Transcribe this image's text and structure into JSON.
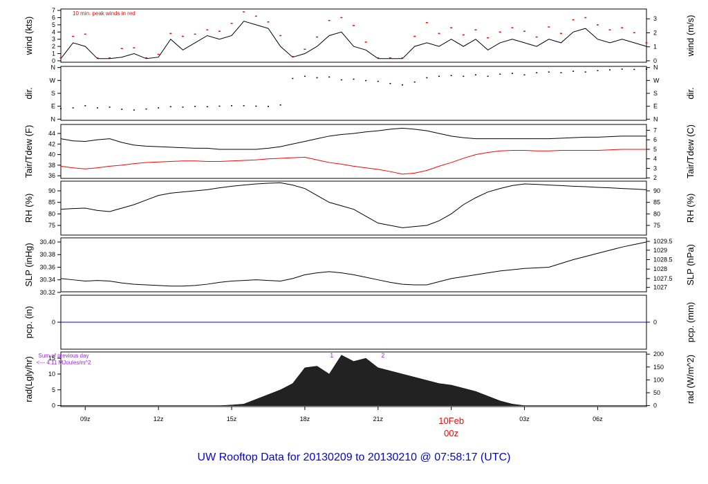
{
  "chart_data": {
    "type": "line",
    "title": "UW Rooftop Data for 20130209  to  20130210 @ 07:58:17  (UTC)",
    "time_axis": {
      "start": "20130209 08z",
      "step_hours": 0.5,
      "range_hours": [
        0,
        24
      ],
      "ticks": [
        {
          "hour": 1,
          "label": "09z"
        },
        {
          "hour": 4,
          "label": "12z"
        },
        {
          "hour": 7,
          "label": "15z"
        },
        {
          "hour": 10,
          "label": "18z"
        },
        {
          "hour": 13,
          "label": "21z"
        },
        {
          "hour": 16,
          "label": "00z",
          "date": "10Feb"
        },
        {
          "hour": 19,
          "label": "03z"
        },
        {
          "hour": 22,
          "label": "06z"
        }
      ]
    },
    "colors": {
      "main": "#000000",
      "peak": "#ff0000",
      "dewpoint": "#ff0000",
      "precip": "#0000ff",
      "annotation": "#a020f0",
      "title": "#0000ee",
      "date": "#ff0000"
    },
    "panels": [
      {
        "id": "wind",
        "left_label": "wind (kts)",
        "right_label": "wind (m/s)",
        "ylim": [
          -0.2,
          7.2
        ],
        "left_ticks": [
          {
            "v": 0,
            "label": "0"
          },
          {
            "v": 1,
            "label": "1"
          },
          {
            "v": 2,
            "label": "2"
          },
          {
            "v": 3,
            "label": "3"
          },
          {
            "v": 4,
            "label": "4"
          },
          {
            "v": 5,
            "label": "5"
          },
          {
            "v": 6,
            "label": "6"
          },
          {
            "v": 7,
            "label": "7"
          }
        ],
        "right_ticks": [
          {
            "v": 0,
            "label": "0"
          },
          {
            "v": 1.944,
            "label": "1"
          },
          {
            "v": 3.888,
            "label": "2"
          },
          {
            "v": 5.832,
            "label": "3"
          }
        ],
        "annotation": "10 min. peak winds in red",
        "series": [
          {
            "name": "wind speed",
            "style": "line",
            "color": "#000000",
            "values": [
              0.3,
              2.5,
              2.0,
              0.3,
              0.3,
              0.5,
              1.0,
              0.3,
              0.5,
              3.0,
              1.5,
              2.5,
              3.5,
              3.0,
              3.5,
              5.5,
              5.0,
              4.5,
              2.0,
              0.5,
              1.0,
              2.0,
              3.5,
              4.0,
              2.0,
              1.5,
              0.3,
              0.3,
              0.3,
              2.0,
              2.5,
              2.0,
              3.0,
              2.0,
              3.0,
              1.5,
              2.5,
              3.0,
              2.5,
              2.0,
              3.0,
              2.5,
              4.0,
              4.5,
              3.0,
              2.5,
              3.0,
              2.5,
              2.0
            ]
          },
          {
            "name": "10 min. peak wind",
            "style": "dash",
            "color": "#ff0000",
            "values": [
              0.4,
              3.4,
              3.7,
              0.4,
              0.4,
              1.7,
              1.8,
              0.4,
              0.9,
              3.8,
              3.4,
              3.7,
              4.3,
              4.1,
              5.2,
              6.8,
              6.2,
              5.4,
              3.5,
              0.6,
              1.6,
              3.3,
              5.6,
              6.0,
              4.9,
              2.6,
              0.4,
              0.4,
              0.4,
              3.4,
              5.3,
              3.8,
              4.6,
              3.6,
              4.3,
              3.2,
              4.0,
              4.6,
              4.1,
              3.3,
              4.7,
              3.8,
              5.7,
              6.0,
              5.0,
              4.3,
              4.6,
              3.9,
              2.5
            ]
          }
        ]
      },
      {
        "id": "dir",
        "left_label": "dir.",
        "right_label": "dir.",
        "ylim": [
          -8,
          368
        ],
        "left_ticks": [
          {
            "v": 0,
            "label": "N"
          },
          {
            "v": 90,
            "label": "E"
          },
          {
            "v": 180,
            "label": "S"
          },
          {
            "v": 270,
            "label": "W"
          },
          {
            "v": 360,
            "label": "N"
          }
        ],
        "right_ticks": [
          {
            "v": 0,
            "label": "N"
          },
          {
            "v": 90,
            "label": "E"
          },
          {
            "v": 180,
            "label": "S"
          },
          {
            "v": 270,
            "label": "W"
          },
          {
            "v": 360,
            "label": "N"
          }
        ],
        "series": [
          {
            "name": "wind direction",
            "style": "points",
            "color": "#000000",
            "values": [
              75,
              80,
              95,
              80,
              85,
              70,
              65,
              72,
              80,
              88,
              85,
              90,
              88,
              92,
              95,
              95,
              92,
              90,
              100,
              285,
              300,
              290,
              295,
              275,
              280,
              270,
              265,
              250,
              240,
              260,
              290,
              300,
              305,
              300,
              310,
              300,
              315,
              320,
              310,
              325,
              330,
              325,
              335,
              330,
              340,
              345,
              350,
              348,
              350
            ]
          }
        ]
      },
      {
        "id": "temp",
        "left_label": "Tair/Tdew (F)",
        "right_label": "Tair/Tdew (C)",
        "ylim": [
          35.5,
          45.7
        ],
        "left_ticks": [
          {
            "v": 36,
            "label": "36"
          },
          {
            "v": 38,
            "label": "38"
          },
          {
            "v": 40,
            "label": "40"
          },
          {
            "v": 42,
            "label": "42"
          },
          {
            "v": 44,
            "label": "44"
          }
        ],
        "right_ticks": [
          {
            "v": 35.6,
            "label": "2"
          },
          {
            "v": 37.4,
            "label": "3"
          },
          {
            "v": 39.2,
            "label": "4"
          },
          {
            "v": 41,
            "label": "5"
          },
          {
            "v": 42.8,
            "label": "6"
          },
          {
            "v": 44.6,
            "label": "7"
          }
        ],
        "series": [
          {
            "name": "air temperature",
            "style": "line",
            "color": "#000000",
            "values": [
              43.0,
              42.6,
              42.5,
              42.8,
              43.0,
              42.3,
              41.8,
              41.6,
              41.5,
              41.4,
              41.3,
              41.2,
              41.2,
              41.0,
              41.0,
              41.0,
              41.0,
              41.2,
              41.5,
              42.0,
              42.5,
              43.0,
              43.5,
              43.8,
              44.0,
              44.3,
              44.5,
              44.8,
              45.0,
              44.8,
              44.5,
              44.0,
              43.5,
              43.2,
              43.0,
              43.0,
              43.0,
              43.0,
              43.0,
              43.0,
              43.0,
              43.1,
              43.2,
              43.3,
              43.3,
              43.4,
              43.5,
              43.5,
              43.5
            ]
          },
          {
            "name": "dew point",
            "style": "line",
            "color": "#ff0000",
            "values": [
              37.8,
              37.5,
              37.3,
              37.5,
              37.8,
              38.0,
              38.3,
              38.5,
              38.6,
              38.7,
              38.8,
              38.8,
              38.7,
              38.7,
              38.8,
              38.9,
              39.0,
              39.2,
              39.3,
              39.4,
              39.5,
              39.0,
              38.5,
              38.2,
              37.8,
              37.5,
              37.2,
              36.8,
              36.3,
              36.5,
              37.0,
              37.8,
              38.5,
              39.3,
              40.0,
              40.4,
              40.7,
              40.8,
              40.8,
              40.7,
              40.7,
              40.8,
              40.8,
              40.8,
              40.8,
              40.9,
              41.0,
              41.0,
              41.0
            ]
          }
        ]
      },
      {
        "id": "rh",
        "left_label": "RH (%)",
        "right_label": "RH (%)",
        "ylim": [
          70.8,
          94.2
        ],
        "left_ticks": [
          {
            "v": 75,
            "label": "75"
          },
          {
            "v": 80,
            "label": "80"
          },
          {
            "v": 85,
            "label": "85"
          },
          {
            "v": 90,
            "label": "90"
          }
        ],
        "right_ticks": [
          {
            "v": 75,
            "label": "75"
          },
          {
            "v": 80,
            "label": "80"
          },
          {
            "v": 85,
            "label": "85"
          },
          {
            "v": 90,
            "label": "90"
          }
        ],
        "series": [
          {
            "name": "relative humidity",
            "style": "line",
            "color": "#000000",
            "values": [
              82,
              82.3,
              82.5,
              81.5,
              81,
              82.5,
              84,
              86,
              88,
              89,
              89.5,
              90,
              90.5,
              91.3,
              92,
              92.5,
              93,
              93.3,
              93.5,
              92.5,
              91,
              88,
              85,
              83.5,
              82,
              79,
              76,
              75,
              74,
              74.5,
              75,
              77,
              80,
              84,
              87,
              89.5,
              91,
              92.3,
              93,
              92.8,
              92.5,
              92.3,
              92,
              91.8,
              91.5,
              91.3,
              91,
              90.8,
              90.5
            ]
          }
        ]
      },
      {
        "id": "slp",
        "left_label": "SLP (inHg)",
        "right_label": "SLP (hPa)",
        "ylim": [
          30.321,
          30.4066
        ],
        "left_ticks": [
          {
            "v": 30.32,
            "label": "30.32"
          },
          {
            "v": 30.34,
            "label": "30.34"
          },
          {
            "v": 30.36,
            "label": "30.36"
          },
          {
            "v": 30.38,
            "label": "30.38"
          },
          {
            "v": 30.4,
            "label": "30.40"
          }
        ],
        "right_ticks": [
          {
            "v": 30.328,
            "label": "1027"
          },
          {
            "v": 30.342,
            "label": "1027.5"
          },
          {
            "v": 30.357,
            "label": "1028"
          },
          {
            "v": 30.372,
            "label": "1028.5"
          },
          {
            "v": 30.387,
            "label": "1029"
          },
          {
            "v": 30.401,
            "label": "1029.5"
          }
        ],
        "series": [
          {
            "name": "sea level pressure",
            "style": "line",
            "color": "#000000",
            "values": [
              30.342,
              30.34,
              30.338,
              30.339,
              30.338,
              30.335,
              30.333,
              30.332,
              30.331,
              30.33,
              30.33,
              30.331,
              30.333,
              30.336,
              30.338,
              30.339,
              30.34,
              30.339,
              30.338,
              30.342,
              30.348,
              30.351,
              30.353,
              30.351,
              30.348,
              30.344,
              30.34,
              30.336,
              30.333,
              30.332,
              30.332,
              30.337,
              30.342,
              30.345,
              30.348,
              30.351,
              30.354,
              30.356,
              30.358,
              30.359,
              30.36,
              30.366,
              30.372,
              30.377,
              30.382,
              30.387,
              30.392,
              30.396,
              30.4
            ]
          }
        ]
      },
      {
        "id": "pcp",
        "left_label": "pcp. (in)",
        "right_label": "pcp. (mm)",
        "ylim": [
          -1,
          1
        ],
        "left_ticks": [
          {
            "v": 0,
            "label": "0"
          }
        ],
        "right_ticks": [
          {
            "v": 0,
            "label": "0"
          }
        ],
        "series": [
          {
            "name": "precipitation",
            "style": "line",
            "color": "#0000ff",
            "values": [
              0,
              0,
              0,
              0,
              0,
              0,
              0,
              0,
              0,
              0,
              0,
              0,
              0,
              0,
              0,
              0,
              0,
              0,
              0,
              0,
              0,
              0,
              0,
              0,
              0,
              0,
              0,
              0,
              0,
              0,
              0,
              0,
              0,
              0,
              0,
              0,
              0,
              0,
              0,
              0,
              0,
              0,
              0,
              0,
              0,
              0,
              0,
              0,
              0
            ]
          }
        ]
      },
      {
        "id": "rad",
        "left_label": "rad(Lgly/hr)",
        "right_label": "rad (W/m^2)",
        "ylim": [
          -0.3,
          17
        ],
        "left_ticks": [
          {
            "v": 0,
            "label": "0"
          },
          {
            "v": 5,
            "label": "5"
          },
          {
            "v": 10,
            "label": "10"
          },
          {
            "v": 15,
            "label": "15"
          }
        ],
        "right_ticks": [
          {
            "v": 0,
            "label": "0"
          },
          {
            "v": 4.08,
            "label": "50"
          },
          {
            "v": 8.15,
            "label": "100"
          },
          {
            "v": 12.23,
            "label": "150"
          },
          {
            "v": 16.3,
            "label": "200"
          }
        ],
        "annotation_lines": [
          "Sum of previous day",
          "<--- 4.11 MJoules/m^2"
        ],
        "markers": [
          {
            "hour": 11.1,
            "label": "1"
          },
          {
            "hour": 13.2,
            "label": "2"
          }
        ],
        "series": [
          {
            "name": "solar radiation",
            "style": "area",
            "color": "#222222",
            "values": [
              0,
              0,
              0,
              0,
              0,
              0,
              0,
              0,
              0,
              0,
              0,
              0,
              0,
              0,
              0.2,
              0.5,
              2,
              3.5,
              5,
              7,
              12,
              12.5,
              10,
              16,
              14,
              15,
              12,
              11,
              10,
              9,
              8,
              7,
              6.5,
              5.5,
              4.5,
              3,
              1.5,
              0.5,
              0,
              0,
              0,
              0,
              0,
              0,
              0,
              0,
              0,
              0,
              0
            ]
          }
        ]
      }
    ]
  }
}
